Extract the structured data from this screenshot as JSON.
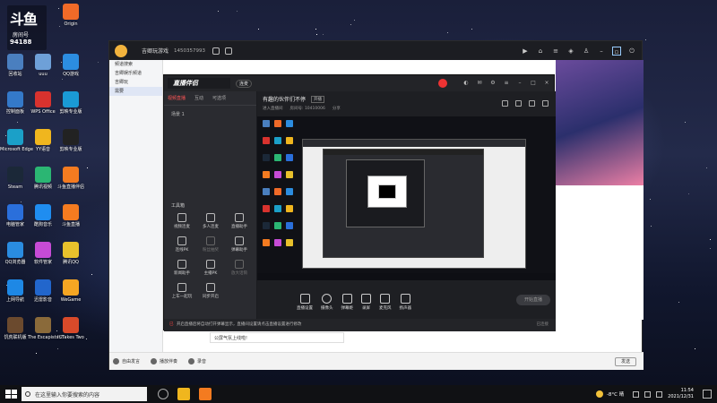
{
  "desktop": {
    "badge": {
      "logo": "斗鱼",
      "line1": "房间号",
      "line2": "94188"
    },
    "icons": [
      {
        "label": "Origin",
        "color": "#f06a28"
      },
      {
        "label": "回收站",
        "color": "#4a7fbf"
      },
      {
        "label": "uuu",
        "color": "#6ea0d8"
      },
      {
        "label": "QQ游戏",
        "color": "#2c8de0"
      },
      {
        "label": "控制面板",
        "color": "#3479c9"
      },
      {
        "label": "WPS Office",
        "color": "#d8322e"
      },
      {
        "label": "剪映专业版",
        "color": "#1a9ad6"
      },
      {
        "label": "Microsoft Edge",
        "color": "#1ba0c8"
      },
      {
        "label": "YY语音",
        "color": "#f0b61e"
      },
      {
        "label": "剪映专业版",
        "color": "#222222"
      },
      {
        "label": "Steam",
        "color": "#1b2838"
      },
      {
        "label": "腾讯视频",
        "color": "#2bb673"
      },
      {
        "label": "斗鱼直播伴侣",
        "color": "#f47b20"
      },
      {
        "label": "电脑管家",
        "color": "#2a6fdb"
      },
      {
        "label": "酷狗音乐",
        "color": "#1f8df0"
      },
      {
        "label": "斗鱼直播",
        "color": "#f47b20"
      },
      {
        "label": "QQ浏览器",
        "color": "#2a8ce0"
      },
      {
        "label": "软件管家",
        "color": "#c64bd6"
      },
      {
        "label": "腾讯QQ",
        "color": "#e8c12c"
      },
      {
        "label": "上网导航",
        "color": "#1e88e5"
      },
      {
        "label": "迅雷影音",
        "color": "#2266cc"
      },
      {
        "label": "WeGame",
        "color": "#f5a623"
      },
      {
        "label": "饥荒联机版",
        "color": "#6b4a2e"
      },
      {
        "label": "The Escapists 2",
        "color": "#8a6a3a"
      },
      {
        "label": "It Takes Two",
        "color": "#d84a2a"
      }
    ]
  },
  "app": {
    "username": "吉卿玩游戏",
    "uid": "1450357993",
    "left_rows": [
      "频道搜索",
      "吉卿娱乐频道",
      "吉卿玩",
      "需要"
    ],
    "chat_input": "公屏气氛上线啦!",
    "bottom": [
      "自由发言",
      "播放伴奏",
      "录音"
    ],
    "send_label": "发送"
  },
  "companion": {
    "logo": "直播伴侣",
    "pill": "连麦",
    "tabs": [
      "视频直播",
      "互动",
      "可选项"
    ],
    "scene": "场景 1",
    "tools_header": "工具箱",
    "tools": [
      {
        "label": "视频连麦",
        "dim": false
      },
      {
        "label": "多人连麦",
        "dim": false
      },
      {
        "label": "直播助手",
        "dim": false
      },
      {
        "label": "连线PK",
        "dim": false
      },
      {
        "label": "粉丝抽奖",
        "dim": true
      },
      {
        "label": "弹幕助手",
        "dim": false
      },
      {
        "label": "新闻助手",
        "dim": false
      },
      {
        "label": "主播PK",
        "dim": false
      },
      {
        "label": "放大话筒",
        "dim": true
      },
      {
        "label": "上车一起玩",
        "dim": false
      },
      {
        "label": "同步开启",
        "dim": false
      }
    ],
    "room_title": "有趣的伙伴们不停",
    "room_tag": "开播",
    "sub": [
      "进入直播间",
      "房间号: 10410006",
      "分享"
    ],
    "controls": [
      "直播设置",
      "摄像头",
      "弹幕姬",
      "录屏",
      "麦克风",
      "扬声器"
    ],
    "start_label": "开始直播",
    "footer_ok": "已",
    "footer": "开启直播后将自动打开弹幕显示，直播间设置请点击直播设置进行修改",
    "footer_right": "已连接"
  },
  "taskbar": {
    "search_placeholder": "在这里输入你要搜索的内容",
    "temp": "-8°C 晴",
    "time": "11:54",
    "date": "2021/12/31"
  }
}
